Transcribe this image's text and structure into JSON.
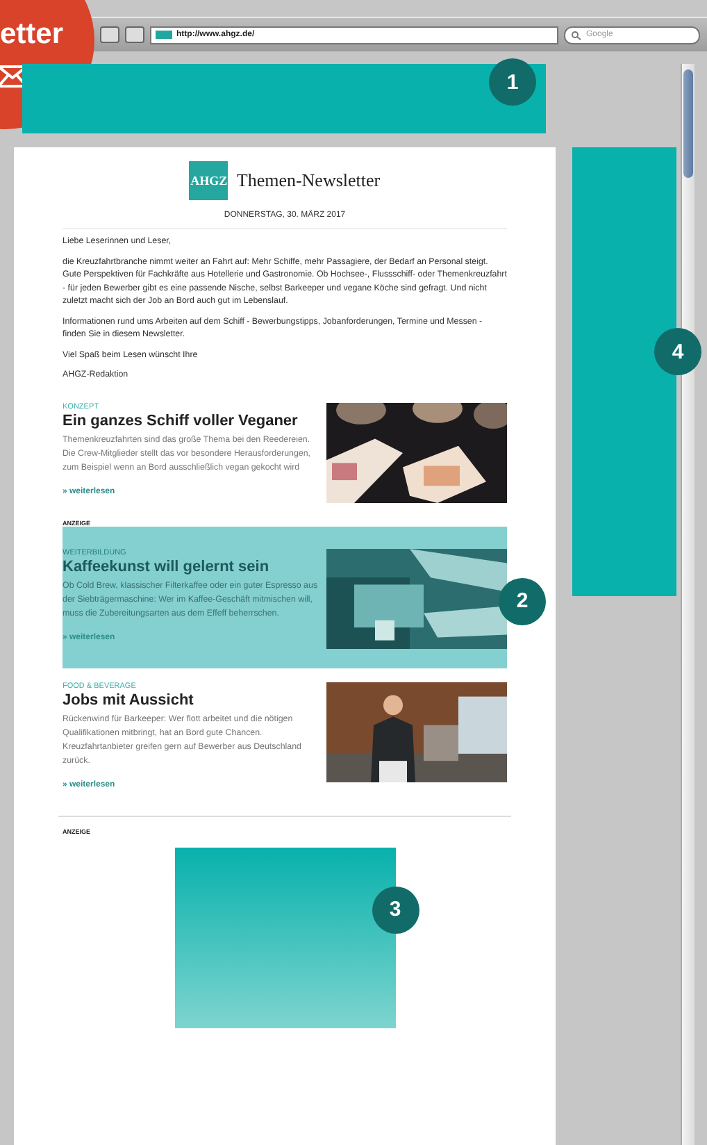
{
  "badge": {
    "text": "etter"
  },
  "browser": {
    "url": "http://www.ahgz.de/",
    "search_placeholder": "Google"
  },
  "banner_ad": {
    "marker": "1"
  },
  "skyscraper_ad": {
    "marker": "4"
  },
  "newsletter": {
    "logo": "AHGZ",
    "title": "Themen-Newsletter",
    "date": "DONNERSTAG, 30. MÄRZ 2017",
    "intro": [
      "Liebe Leserinnen und Leser,",
      "die Kreuzfahrtbranche nimmt weiter an Fahrt auf: Mehr Schiffe, mehr Passagiere, der Bedarf an Personal steigt. Gute Perspektiven für Fachkräfte aus Hotellerie und Gastronomie. Ob Hochsee-, Flussschiff- oder Themenkreuzfahrt - für jeden Bewerber gibt es eine passende Nische, selbst Barkeeper und vegane Köche sind gefragt. Und nicht zuletzt macht sich der Job an Bord auch gut im Lebenslauf.",
      "Informationen rund ums Arbeiten auf dem Schiff - Bewerbungstipps, Jobanforderungen, Termine und Messen - finden Sie in diesem Newsletter.",
      "Viel Spaß beim Lesen wünscht Ihre",
      "AHGZ-Redaktion"
    ],
    "articles": [
      {
        "kind": "article",
        "category": "KONZEPT",
        "title": "Ein ganzes Schiff voller Veganer",
        "body": "Themenkreuzfahrten sind das große Thema bei den Reedereien. Die Crew-Mitglieder stellt das vor besondere Herausforderungen, zum Beispiel wenn an Bord ausschließlich vegan gekocht wird",
        "link": "» weiterlesen"
      },
      {
        "kind": "sponsored",
        "label": "ANZEIGE",
        "marker": "2",
        "category": "WEITERBILDUNG",
        "title": "Kaffeekunst will gelernt sein",
        "body": "Ob Cold Brew, klassischer Filterkaffee oder ein guter Espresso aus der Siebträgermaschine: Wer im Kaffee-Geschäft mitmischen will, muss die Zubereitungsarten aus dem Effeff beherrschen.",
        "link": "» weiterlesen"
      },
      {
        "kind": "article",
        "category": "FOOD & BEVERAGE",
        "title": "Jobs mit Aussicht",
        "body": "Rückenwind für Barkeeper: Wer flott arbeitet und die nötigen Qualifikationen mitbringt, hat an Bord gute Chancen. Kreuzfahrtanbieter greifen gern auf Bewerber aus Deutschland zurück.",
        "link": "» weiterlesen"
      }
    ],
    "bottom_ad": {
      "label": "ANZEIGE",
      "marker": "3"
    }
  }
}
